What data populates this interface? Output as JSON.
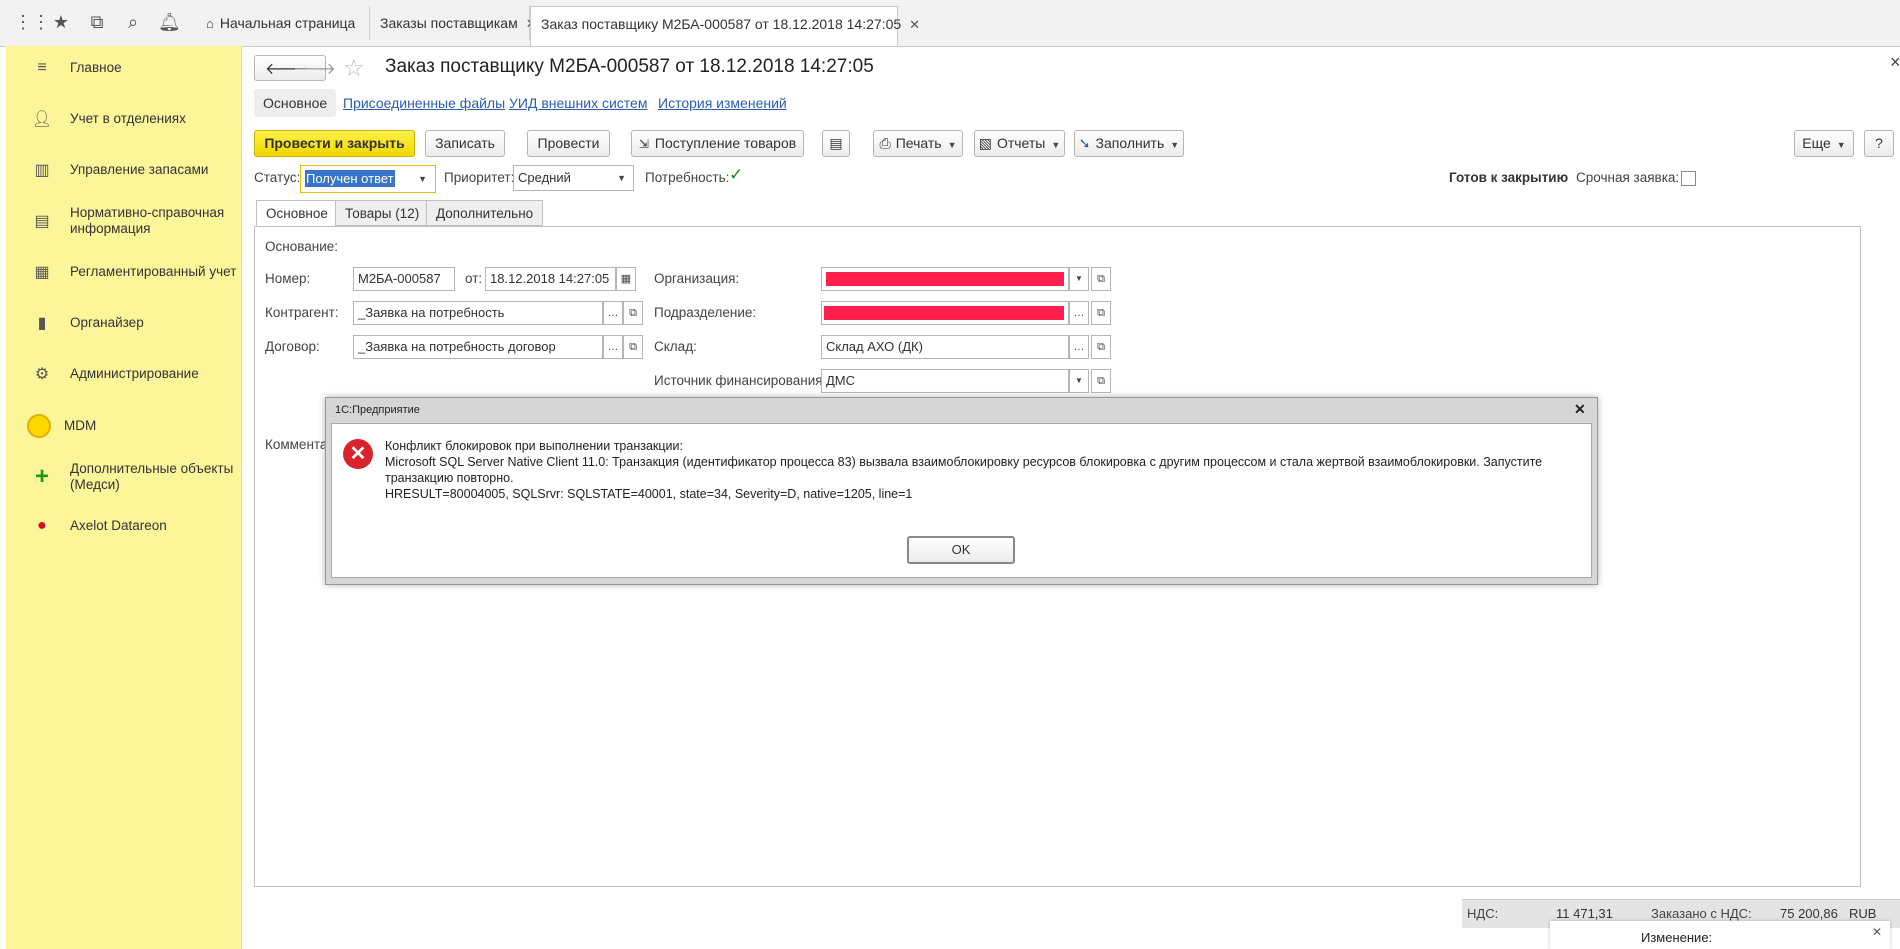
{
  "topbar": {
    "icons": [
      "apps-grid-icon",
      "star-icon",
      "history-icon",
      "search-icon",
      "bell-icon",
      "home-icon"
    ],
    "tabs": [
      {
        "label": "Начальная страница"
      },
      {
        "label": "Заказы поставщикам",
        "close": "✕"
      },
      {
        "label": "Заказ поставщику М2БА-000587 от 18.12.2018 14:27:05",
        "close": "✕"
      }
    ]
  },
  "sidebar": {
    "items": [
      {
        "label": "Главное",
        "icon": "menu-icon"
      },
      {
        "label": "Учет в отделениях",
        "icon": "user-icon"
      },
      {
        "label": "Управление запасами",
        "icon": "building-icon"
      },
      {
        "label": "Нормативно-справочная информация",
        "icon": "book-icon"
      },
      {
        "label": "Регламентированный учет",
        "icon": "ledger-icon"
      },
      {
        "label": "Органайзер",
        "icon": "chart-icon"
      },
      {
        "label": "Администрирование",
        "icon": "gear-icon"
      },
      {
        "label": "MDM",
        "icon": "mdm-circle-icon"
      },
      {
        "label": "Дополнительные объекты (Медси)",
        "icon": "plus-icon"
      },
      {
        "label": "Axelot Datareon",
        "icon": "datareon-icon"
      }
    ]
  },
  "document": {
    "title": "Заказ поставщику М2БА-000587 от 18.12.2018 14:27:05",
    "close": "×",
    "subnav": [
      "Основное",
      "Присоединенные файлы",
      "УИД внешних систем",
      "История изменений"
    ],
    "toolbar": {
      "post_close": "Провести и закрыть",
      "save": "Записать",
      "post": "Провести",
      "receipt": "Поступление товаров",
      "print": "Печать",
      "reports": "Отчеты",
      "fill": "Заполнить",
      "more": "Еще",
      "help": "?"
    },
    "status_label": "Статус:",
    "status_value": "Получен ответ",
    "priority_label": "Приоритет:",
    "priority_value": "Средний",
    "need_label": "Потребность:",
    "need_checked": "✓",
    "ready_label": "Готов к закрытию",
    "urgent_label": "Срочная заявка:",
    "tabs": [
      "Основное",
      "Товары (12)",
      "Дополнительно"
    ],
    "form": {
      "basis_label": "Основание:",
      "number_label": "Номер:",
      "number_value": "М2БА-000587",
      "from_label": "от:",
      "date_value": "18.12.2018 14:27:05",
      "counterparty_label": "Контрагент:",
      "counterparty_value": "_Заявка на потребность",
      "contract_label": "Договор:",
      "contract_value": "_Заявка на потребность договор",
      "org_label": "Организация:",
      "dept_label": "Подразделение:",
      "warehouse_label": "Склад:",
      "warehouse_value": "Склад АХО (ДК)",
      "funding_label": "Источник финансирования:",
      "funding_value": "ДМС",
      "comment_label": "Коммента"
    },
    "footer": {
      "vat_label": "НДС:",
      "vat_value": "11 471,31",
      "ordered_label": "Заказано с НДС:",
      "ordered_value": "75 200,86",
      "currency": "RUB",
      "change_label": "Изменение:"
    }
  },
  "dialog": {
    "title": "1С:Предприятие",
    "close": "✕",
    "lines": [
      "Конфликт блокировок при выполнении транзакции:",
      "Microsoft SQL Server Native Client 11.0: Транзакция (идентификатор процесса 83) вызвала взаимоблокировку ресурсов блокировка с другим процессом и стала жертвой взаимоблокировки. Запустите",
      "транзакцию повторно.",
      "HRESULT=80004005, SQLSrvr: SQLSTATE=40001, state=34, Severity=D, native=1205, line=1"
    ],
    "ok": "OK"
  }
}
